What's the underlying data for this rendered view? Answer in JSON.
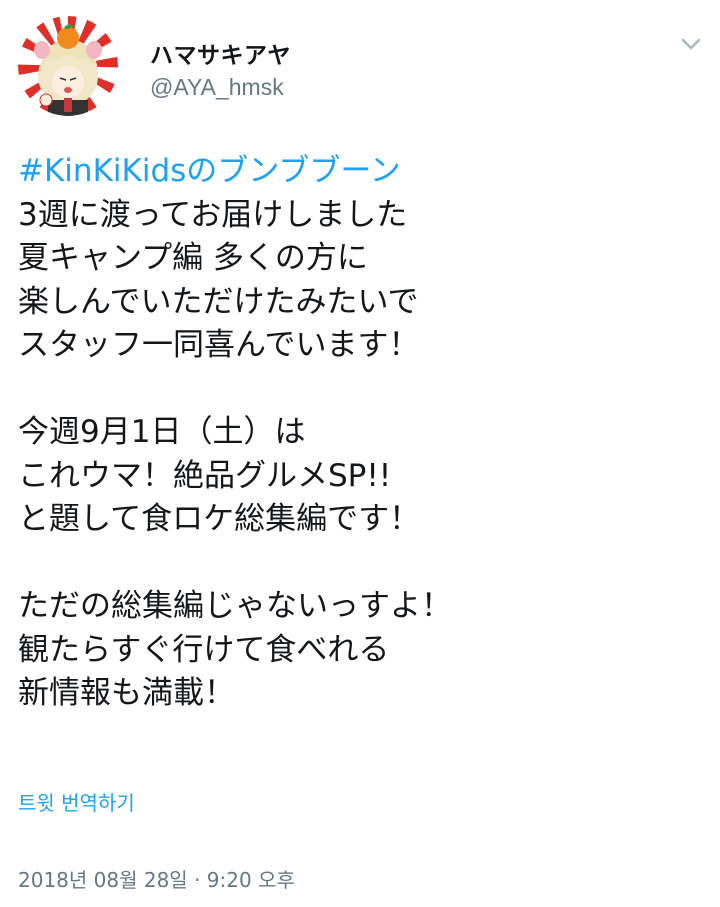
{
  "user": {
    "display_name": "ハマサキアヤ",
    "handle": "@AYA_hmsk"
  },
  "tweet": {
    "hashtag": "#KinKiKidsのブンブブーン",
    "lines": [
      "3週に渡ってお届けしました",
      "夏キャンプ編 多くの方に",
      "楽しんでいただけたみたいで",
      "スタッフ一同喜んでいます！",
      "",
      "今週9月1日（土）は",
      "これウマ！絶品グルメSP!!",
      "と題して食ロケ総集編です！",
      "",
      "ただの総集編じゃないっすよ！",
      "観たらすぐ行けて食べれる",
      "新情報も満載！"
    ]
  },
  "translate_label": "트윗 번역하기",
  "timestamp": "2018년 08월 28일 · 9:20 오후",
  "icons": {
    "menu": "chevron-down-icon",
    "avatar": "avatar-image"
  },
  "colors": {
    "link": "#1da1f2",
    "secondary_text": "#657786",
    "primary_text": "#14171a",
    "avatar_ray_red": "#e02f27"
  }
}
